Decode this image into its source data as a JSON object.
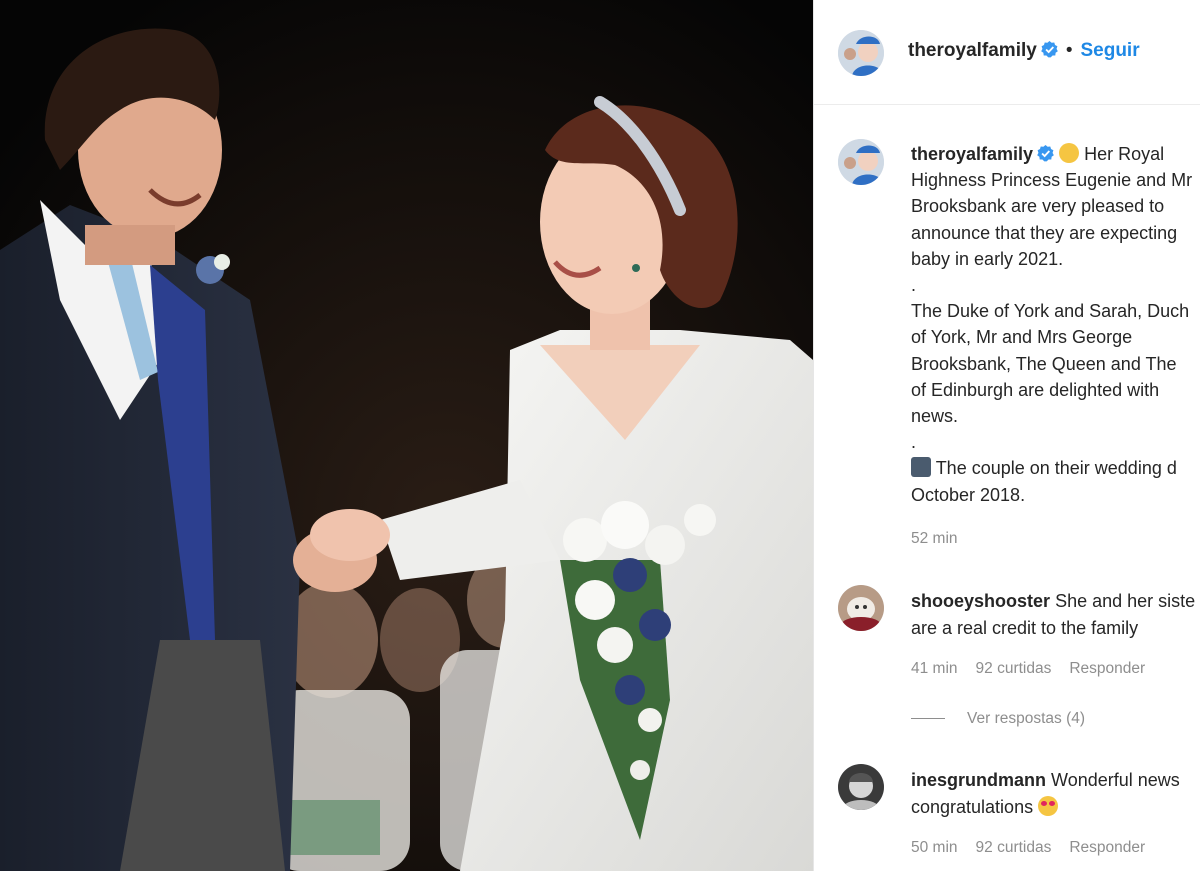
{
  "photo": {
    "alt_subject": "wedding-couple-photo"
  },
  "header": {
    "username": "theroyalfamily",
    "separator": "•",
    "follow_label": "Seguir"
  },
  "caption": {
    "username": "theroyalfamily",
    "line1": "Her Royal",
    "line2": "Highness Princess Eugenie and Mr",
    "line3": "Brooksbank are very pleased to",
    "line4": "announce that they are expecting",
    "line5": "baby in early 2021.",
    "dot1": ".",
    "line6": "The Duke of York and Sarah, Duch",
    "line7": "of York, Mr and Mrs George",
    "line8": "Brooksbank, The Queen and The",
    "line9": "of Edinburgh are delighted with",
    "line10": "news.",
    "dot2": ".",
    "line11": "The couple on their wedding d",
    "line12": "October 2018.",
    "time": "52 min"
  },
  "comments": [
    {
      "username": "shooeyshooster",
      "text_line1": "She and her siste",
      "text_line2": "are a real credit to the family",
      "time": "41 min",
      "likes": "92 curtidas",
      "reply_label": "Responder",
      "view_replies": "Ver respostas (4)"
    },
    {
      "username": "inesgrundmann",
      "text_line1": "Wonderful news",
      "text_line2": "congratulations",
      "time": "50 min",
      "likes": "92 curtidas",
      "reply_label": "Responder"
    }
  ],
  "colors": {
    "link_blue": "#1e88e5",
    "verified_blue": "#3897f0",
    "meta_gray": "#8e8e8e",
    "text": "#262626"
  }
}
